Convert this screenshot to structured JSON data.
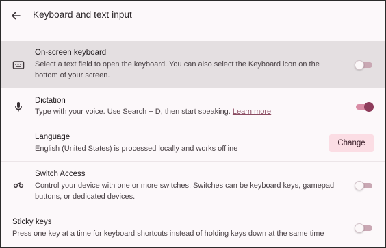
{
  "header": {
    "back_icon": "arrow-back-icon",
    "title": "Keyboard and text input"
  },
  "rows": [
    {
      "icon": "keyboard-icon",
      "title": "On-screen keyboard",
      "description_line1": "Select a text field to open the keyboard. You can also select the Keyboard icon on the",
      "description_line2": "bottom of your screen.",
      "toggle_state": "off"
    },
    {
      "icon": "microphone-icon",
      "title": "Dictation",
      "description": "Type with your voice. Use Search + D, then start speaking.",
      "link": "Learn more",
      "toggle_state": "on"
    },
    {
      "title": "Language",
      "description": "English (United States) is processed locally and works offline",
      "button_label": "Change"
    },
    {
      "icon": "switch-access-icon",
      "title": "Switch Access",
      "description_line1": "Control your device with one or more switches. Switches can be keyboard keys, gamepad",
      "description_line2": "buttons, or dedicated devices.",
      "toggle_state": "off"
    },
    {
      "title": "Sticky keys",
      "description": "Press one key at a time for keyboard shortcuts instead of holding keys down at the same time",
      "toggle_state": "off"
    }
  ],
  "colors": {
    "accent": "#8e3c5b",
    "highlight_row": "#e4dfe1",
    "change_button_bg": "#fbdde4"
  }
}
